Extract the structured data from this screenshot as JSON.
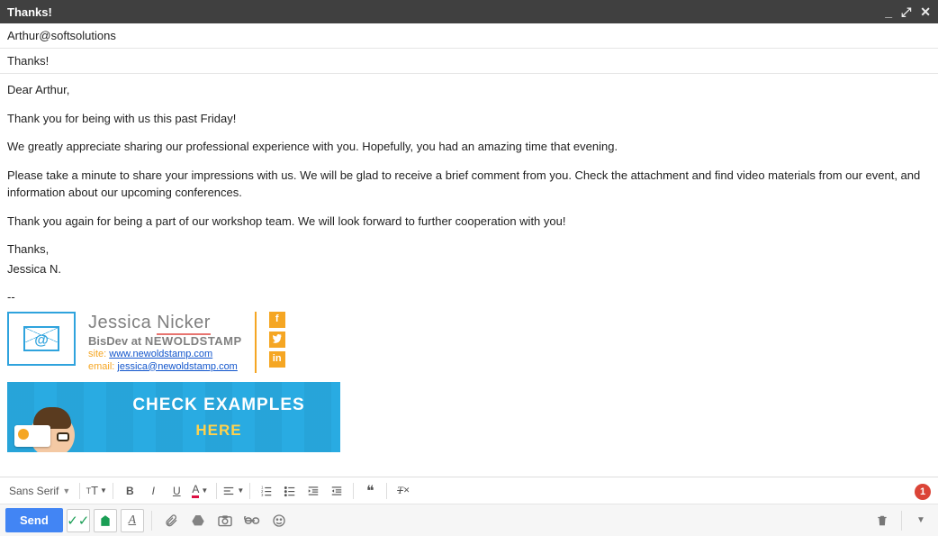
{
  "window": {
    "title": "Thanks!"
  },
  "to": "Arthur@softsolutions",
  "subject": "Thanks!",
  "body": {
    "greeting": "Dear Arthur,",
    "p1": "Thank you for being with us this past Friday!",
    "p2": "We greatly appreciate sharing our professional experience with you. Hopefully, you had an amazing time that evening.",
    "p3": "Please take a minute to share your impressions with us. We will be glad to receive a brief comment from you. Check the attachment and find video materials from our event, and information about our upcoming conferences.",
    "p4": "Thank you again for being a part of our workshop team. We will look forward to further cooperation with you!",
    "thanks": "Thanks,",
    "sender": "Jessica N."
  },
  "signature": {
    "first": "Jessica",
    "last": "Nicker",
    "role_prefix": "BisDev at",
    "company": "NEWOLDSTAMP",
    "site_label": "site:",
    "site_url": "www.newoldstamp.com",
    "email_label": "email:",
    "email": "jessica@newoldstamp.com"
  },
  "banner": {
    "line1": "CHECK EXAMPLES",
    "line2": "HERE"
  },
  "format_toolbar": {
    "font": "Sans Serif",
    "notif_count": "1"
  },
  "actions": {
    "send": "Send"
  }
}
